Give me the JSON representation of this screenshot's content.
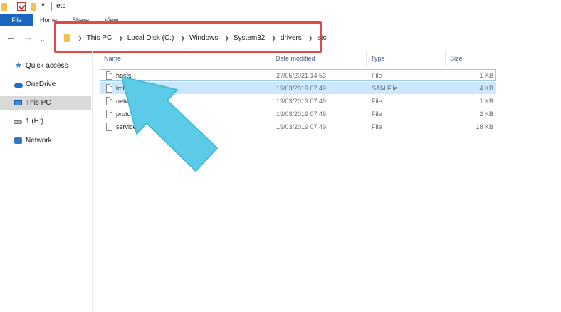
{
  "window": {
    "title": "etc"
  },
  "ribbon": {
    "tabs": [
      {
        "label": "File"
      },
      {
        "label": "Home"
      },
      {
        "label": "Share"
      },
      {
        "label": "View"
      }
    ]
  },
  "address": {
    "crumbs": [
      "This PC",
      "Local Disk (C:)",
      "Windows",
      "System32",
      "drivers",
      "etc"
    ]
  },
  "sidebar": {
    "items": [
      {
        "label": "Quick access",
        "icon": "star-icon"
      },
      {
        "label": "OneDrive",
        "icon": "cloud-icon"
      },
      {
        "label": "This PC",
        "icon": "computer-icon",
        "selected": true
      },
      {
        "label": "1 (H:)",
        "icon": "drive-icon"
      },
      {
        "label": "Network",
        "icon": "network-icon"
      }
    ]
  },
  "columns": {
    "name": "Name",
    "date": "Date modified",
    "type": "Type",
    "size": "Size"
  },
  "files": [
    {
      "name": "hosts",
      "date": "27/05/2021 14:53",
      "type": "File",
      "size": "1 KB",
      "state": "hovered"
    },
    {
      "name": "lmhosts.sam",
      "date": "19/03/2019 07:49",
      "type": "SAM File",
      "size": "4 KB",
      "state": "selected"
    },
    {
      "name": "networks",
      "date": "19/03/2019 07:49",
      "type": "File",
      "size": "1 KB"
    },
    {
      "name": "protocol",
      "date": "19/03/2019 07:49",
      "type": "File",
      "size": "2 KB"
    },
    {
      "name": "services",
      "date": "19/03/2019 07:49",
      "type": "File",
      "size": "18 KB"
    }
  ],
  "colors": {
    "file_tab": "#1a67c0",
    "highlight_box": "#e2474a",
    "arrow": "#5ccbe8",
    "selected_row": "#cce8ff",
    "sidebar_selected": "#d9d9d9"
  }
}
